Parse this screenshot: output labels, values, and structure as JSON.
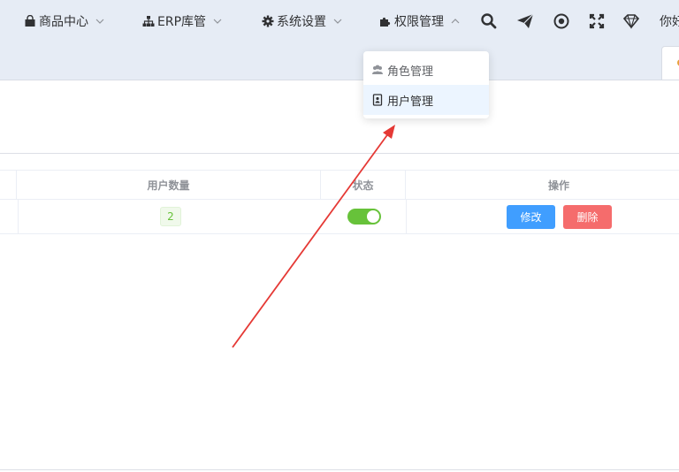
{
  "nav": {
    "items": [
      {
        "label": "商品中心",
        "icon": "shopping-bag-icon"
      },
      {
        "label": "ERP库管",
        "icon": "sitemap-icon"
      },
      {
        "label": "系统设置",
        "icon": "gear-icon"
      },
      {
        "label": "权限管理",
        "icon": "puzzle-icon"
      }
    ],
    "tools": [
      "search-icon",
      "send-icon",
      "record-icon",
      "fullscreen-icon",
      "diamond-icon"
    ],
    "greeting": "你好"
  },
  "dropdown": {
    "items": [
      {
        "label": "角色管理",
        "icon": "users-icon"
      },
      {
        "label": "用户管理",
        "icon": "address-card-icon"
      }
    ]
  },
  "table": {
    "headers": {
      "user_count": "用户数量",
      "status": "状态",
      "actions": "操作"
    },
    "row": {
      "user_count": "2",
      "status_on": true,
      "edit_label": "修改",
      "delete_label": "删除"
    }
  },
  "colors": {
    "header_bg": "#e6ecf5",
    "primary": "#409eff",
    "danger": "#f56c6c",
    "success": "#67c23a",
    "annotation_arrow": "#e53935"
  }
}
